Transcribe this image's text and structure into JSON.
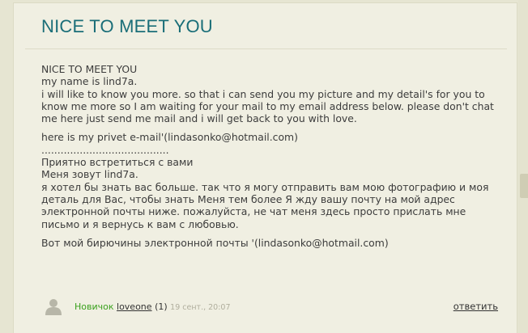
{
  "post": {
    "title": "NICE TO MEET YOU",
    "lines": [
      "NICE TO MEET YOU",
      "my name is lind7a.",
      "i will like to know you more. so that i can send you my picture and my detail's for you to know me more so I am waiting for your mail to my email address below. please don't chat me here just send me mail and i will get back to you with love.",
      "here is my privet e-mail'(lindasonko@hotmail.com)",
      "........................................",
      "Приятно встретиться с вами",
      "Меня зовут lind7a.",
      "я хотел бы знать вас больше. так что я могу отправить вам мою фотографию и моя деталь для Вас, чтобы знать Меня тем более Я жду вашу почту на мой адрес электронной почты ниже. пожалуйста, не чат меня здесь просто прислать мне письмо и я вернусь к вам с любовью.",
      "Вот мой бирючины электронной почты '(lindasonko@hotmail.com)"
    ]
  },
  "footer": {
    "avatar_icon": "user-silhouette-icon",
    "rank": "Новичок",
    "author": "loveone",
    "post_count": "(1)",
    "date": "19 сент., 20:07",
    "reply_label": "ответить"
  },
  "colors": {
    "title": "#1a6e78",
    "rank": "#3aa11d",
    "background": "#f0efe2"
  }
}
